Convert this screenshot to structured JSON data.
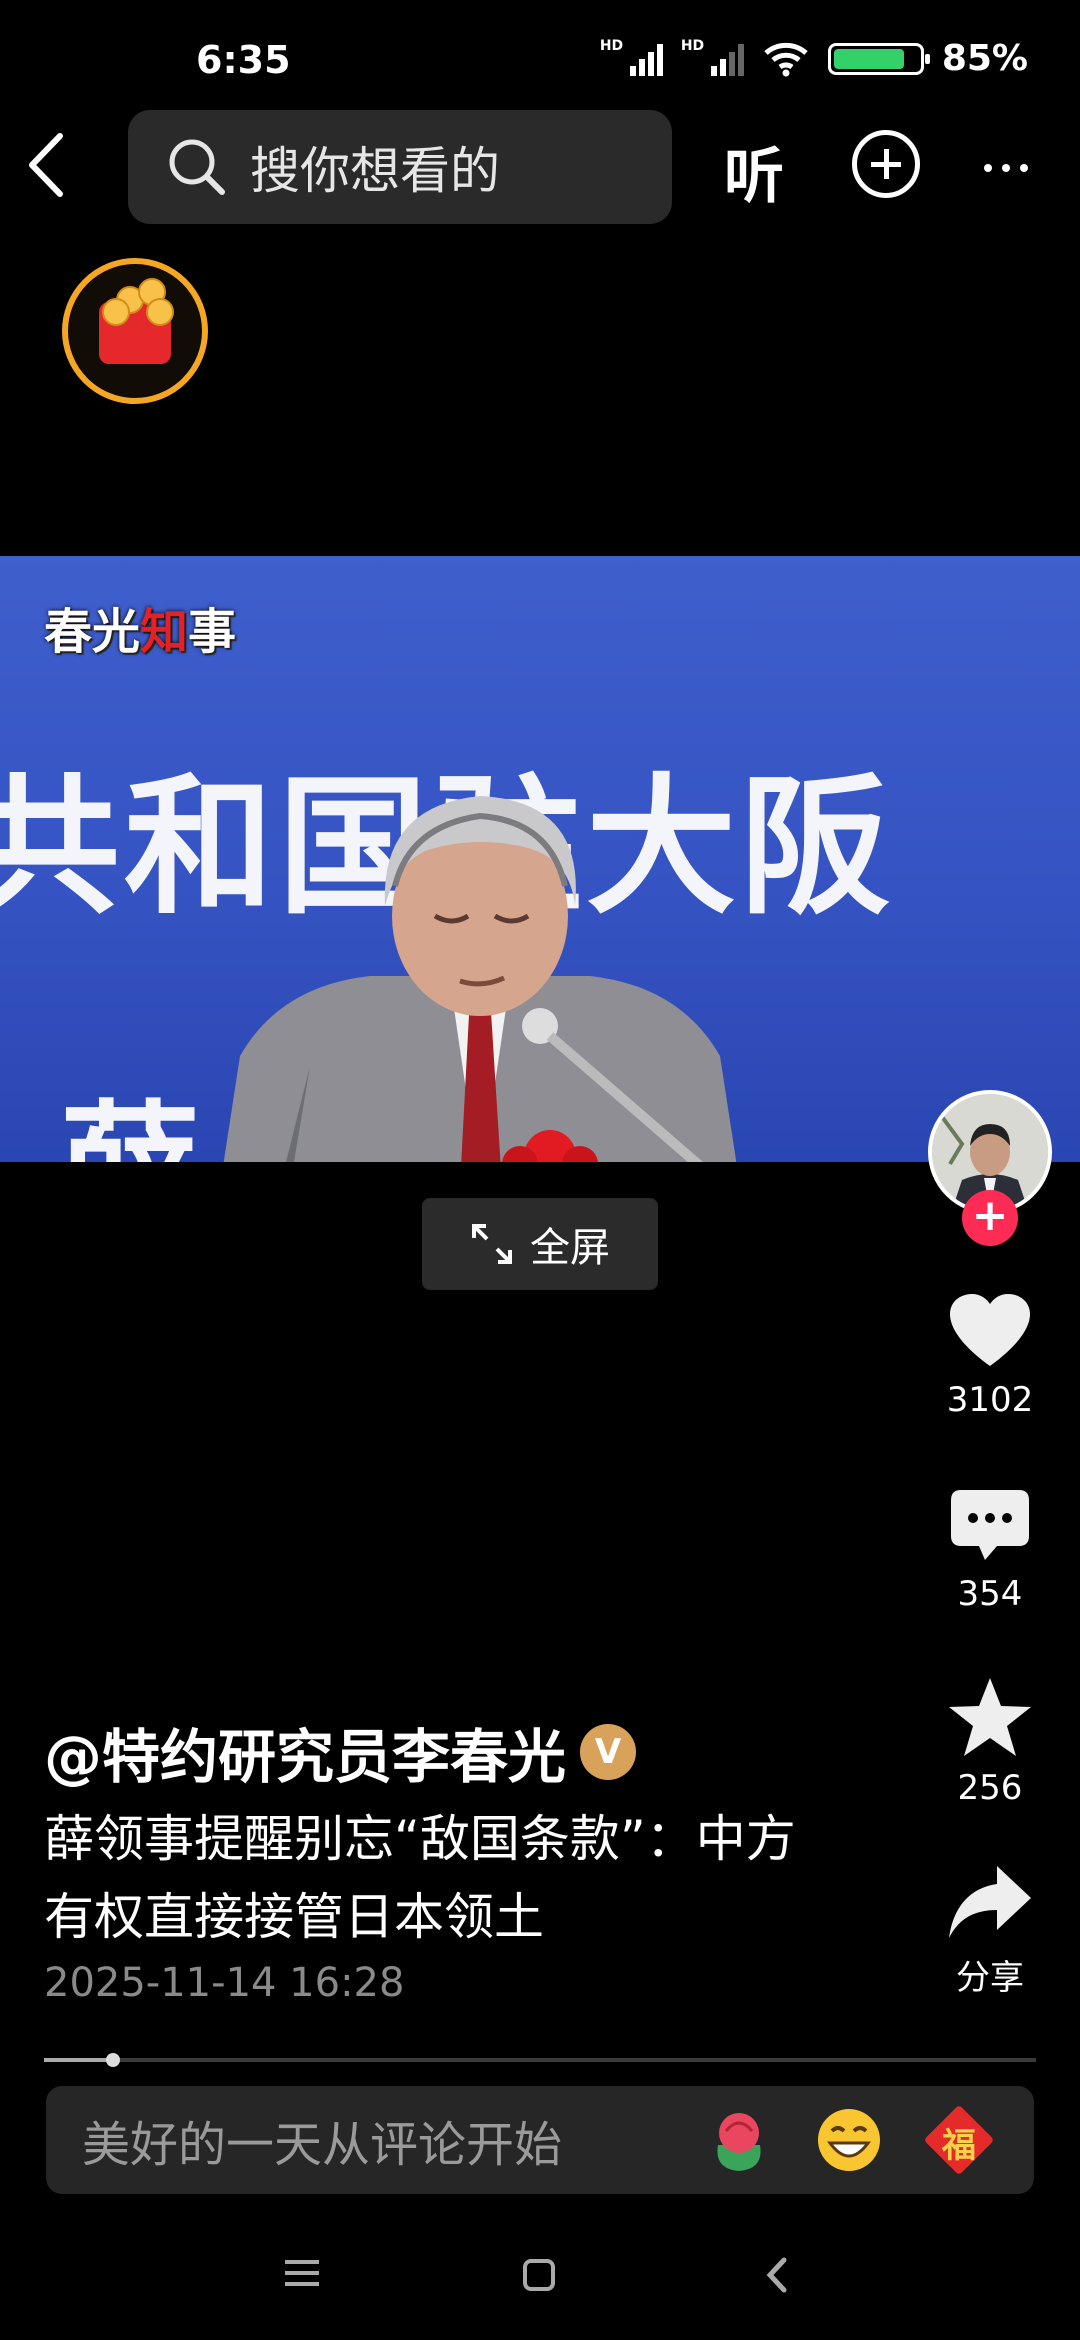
{
  "status": {
    "time": "6:35",
    "battery": "85%",
    "battery_level": 0.85,
    "hd1": "HD",
    "hd2": "HD"
  },
  "topbar": {
    "search_placeholder": "搜你想看的",
    "listen_label": "听"
  },
  "video": {
    "watermark_black": "春光",
    "watermark_red": "知",
    "watermark_tail": "事",
    "banner_text": "共和国驻大阪",
    "banner_lower": "薛",
    "fullscreen_label": "全屏"
  },
  "actions": {
    "likes": "3102",
    "comments": "354",
    "favorites": "256",
    "share_label": "分享"
  },
  "post": {
    "author": "@特约研究员李春光",
    "verified_badge": "V",
    "title": "薛领事提醒别忘“敌国条款”：中方有权直接接管日本领土",
    "date": "2025-11-14 16:28",
    "progress": 0.07
  },
  "comment": {
    "placeholder": "美好的一天从评论开始",
    "emoji_fu": "福"
  },
  "colors": {
    "accent": "#fe2c55",
    "ring": "#f5a623",
    "battery": "#34d16a"
  }
}
